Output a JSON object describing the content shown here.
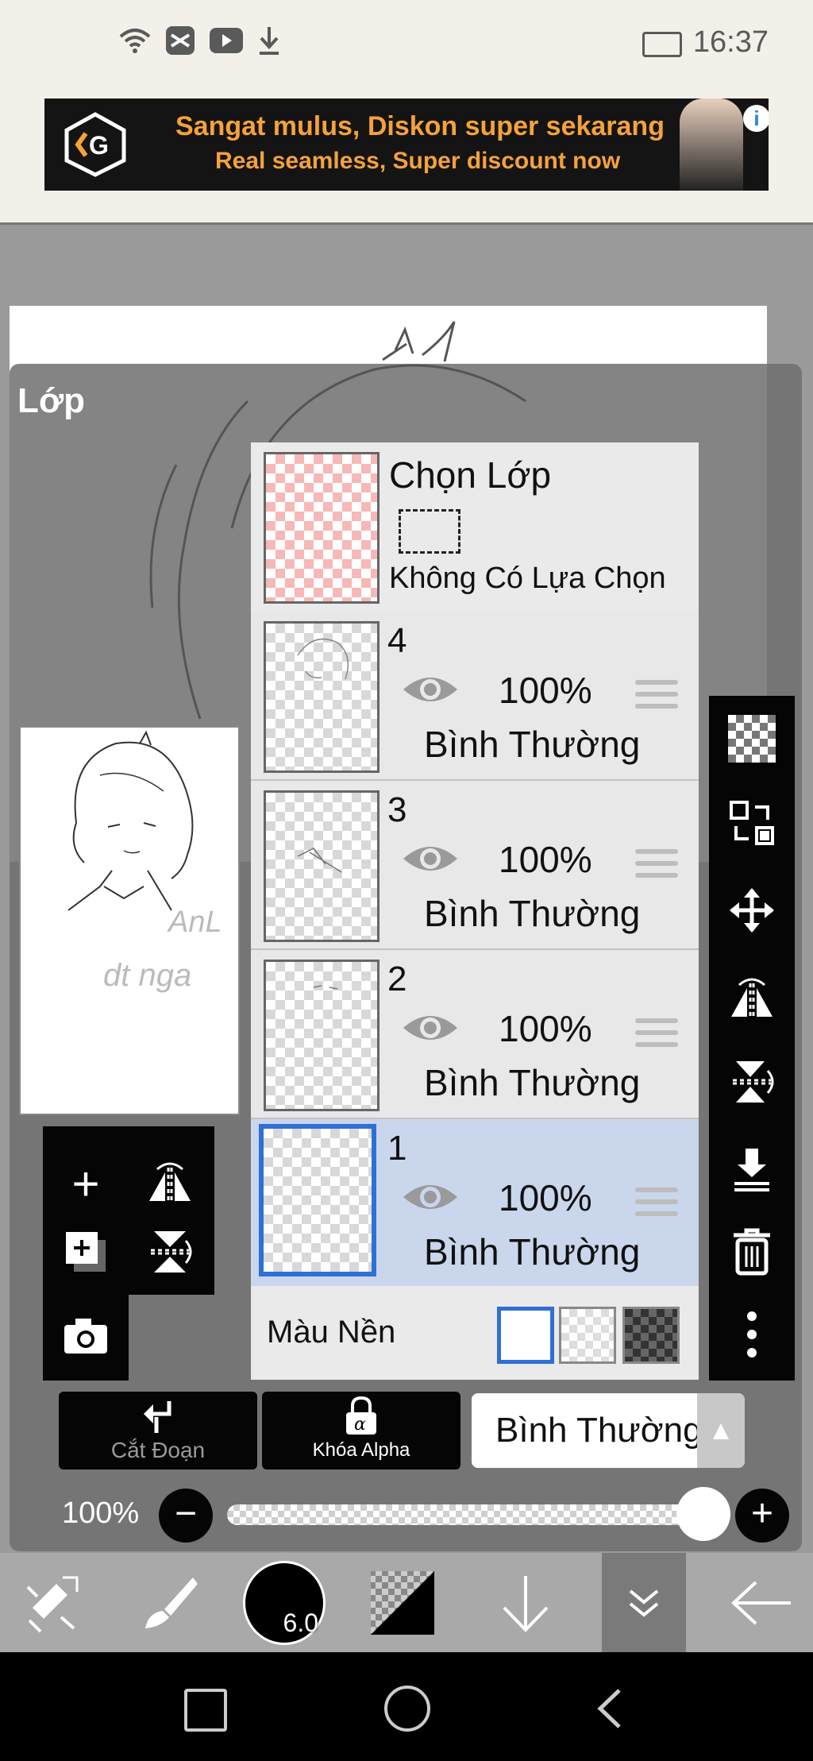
{
  "status_bar": {
    "time": "16:37"
  },
  "ad": {
    "line1": "Sangat mulus, Diskon super sekarang",
    "line2": "Real seamless, Super discount  now"
  },
  "panel_title": "Lớp",
  "selection": {
    "title": "Chọn Lớp",
    "subtitle": "Không Có Lựa Chọn"
  },
  "layers": [
    {
      "number": "4",
      "opacity": "100%",
      "blend": "Bình Thường",
      "active": false
    },
    {
      "number": "3",
      "opacity": "100%",
      "blend": "Bình Thường",
      "active": false
    },
    {
      "number": "2",
      "opacity": "100%",
      "blend": "Bình Thường",
      "active": false
    },
    {
      "number": "1",
      "opacity": "100%",
      "blend": "Bình Thường",
      "active": true
    }
  ],
  "background_color_label": "Màu Nền",
  "buttons": {
    "clipping": "Cắt Đoạn",
    "alpha_lock": "Khóa Alpha"
  },
  "blend_mode": "Bình Thường",
  "opacity": {
    "label": "100%",
    "value": 1.0
  },
  "brush_size": "6.0",
  "preview_signature": [
    "AnL",
    "dt nga"
  ],
  "colors": {
    "active_layer_bg": "#c9d6ec",
    "active_border": "#2f6fd6",
    "ad_text": "#f5a23a"
  }
}
